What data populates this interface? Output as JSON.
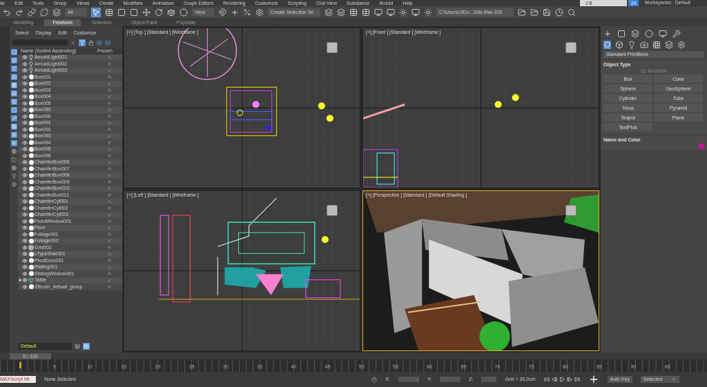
{
  "menu": [
    "ile",
    "Edit",
    "Tools",
    "Group",
    "Views",
    "Create",
    "Modifiers",
    "Animation",
    "Graph Editors",
    "Rendering",
    "Customize",
    "Scripting",
    "Civil View",
    "Substance",
    "Arnold",
    "Help"
  ],
  "account": {
    "user": "J B",
    "badge": "24",
    "workspaces_label": "Workspaces:",
    "workspace": "Default"
  },
  "toolbar": {
    "selection_filter": "All",
    "reference_coord": "View",
    "named_selection": "Create Selection Se",
    "project_path": "C:\\Users\\J\\Do...\\3ds Max 202"
  },
  "ribbon_tabs": [
    {
      "label": "Modeling",
      "selected": false
    },
    {
      "label": "Freeform",
      "selected": true
    },
    {
      "label": "Selection",
      "selected": false
    },
    {
      "label": "Object Paint",
      "selected": false
    },
    {
      "label": "Populate",
      "selected": false
    }
  ],
  "scene_explorer": {
    "menu": [
      "Select",
      "Display",
      "Edit",
      "Customize"
    ],
    "columns": [
      "Name (Sorted Ascending)",
      "Frozen"
    ],
    "rows": [
      {
        "name": "ArnoldLight001",
        "kind": "light"
      },
      {
        "name": "ArnoldLight002",
        "kind": "light"
      },
      {
        "name": "ArnoldLight003",
        "kind": "light"
      },
      {
        "name": "Box001",
        "kind": "object"
      },
      {
        "name": "Box002",
        "kind": "object"
      },
      {
        "name": "Box003",
        "kind": "object"
      },
      {
        "name": "Box004",
        "kind": "object"
      },
      {
        "name": "Box005",
        "kind": "object"
      },
      {
        "name": "Box089",
        "kind": "object"
      },
      {
        "name": "Box090",
        "kind": "object"
      },
      {
        "name": "Box091",
        "kind": "object"
      },
      {
        "name": "Box092",
        "kind": "object"
      },
      {
        "name": "Box093",
        "kind": "object"
      },
      {
        "name": "Box094",
        "kind": "object"
      },
      {
        "name": "Box095",
        "kind": "object"
      },
      {
        "name": "Box096",
        "kind": "object"
      },
      {
        "name": "ChamferBox006",
        "kind": "object"
      },
      {
        "name": "ChamferBox007",
        "kind": "object"
      },
      {
        "name": "ChamferBox008",
        "kind": "object"
      },
      {
        "name": "ChamferBox009",
        "kind": "object"
      },
      {
        "name": "ChamferBox010",
        "kind": "object"
      },
      {
        "name": "ChamferBox011",
        "kind": "object"
      },
      {
        "name": "ChamferCyl001",
        "kind": "object"
      },
      {
        "name": "ChamferCyl002",
        "kind": "object"
      },
      {
        "name": "ChamferCyl003",
        "kind": "object"
      },
      {
        "name": "FixedWindow001",
        "kind": "object"
      },
      {
        "name": "Floor",
        "kind": "object"
      },
      {
        "name": "Foliage001",
        "kind": "object"
      },
      {
        "name": "Foliage002",
        "kind": "object"
      },
      {
        "name": "Grid002",
        "kind": "grid"
      },
      {
        "name": "LTypeStair001",
        "kind": "object"
      },
      {
        "name": "PivotDoor001",
        "kind": "object"
      },
      {
        "name": "Railing001",
        "kind": "object"
      },
      {
        "name": "SlidingWindow001",
        "kind": "object"
      },
      {
        "name": "Table",
        "kind": "group"
      },
      {
        "name": "ZBrush_defualt_group",
        "kind": "object"
      }
    ],
    "layer": "Default"
  },
  "viewports": [
    {
      "label": "[+] [Top ] [Standard ] [Wireframe ]",
      "kind": "top",
      "active": false
    },
    {
      "label": "[+] [Front ] [Standard ] [Wireframe ]",
      "kind": "front",
      "active": false
    },
    {
      "label": "[+] [Left ] [Standard ] [Wireframe ]",
      "kind": "left",
      "active": false
    },
    {
      "label": "[+] [Perspective ] [Standard ] [Default Shading ]",
      "kind": "perspective",
      "active": true
    }
  ],
  "command_panel": {
    "category": "Standard Primitives",
    "object_type": {
      "title": "Object Type",
      "autogrid": {
        "label": "AutoGrid",
        "checked": false
      },
      "buttons": [
        "Box",
        "Cone",
        "Sphere",
        "GeoSphere",
        "Cylinder",
        "Tube",
        "Torus",
        "Pyramid",
        "Teapot",
        "Plane",
        "TextPlus"
      ]
    },
    "name_and_color": {
      "title": "Name and Color",
      "color": "#c21a8c"
    }
  },
  "timeline": {
    "frame": "0 / 100",
    "ticks": [
      "5",
      "10",
      "15",
      "20",
      "25",
      "30",
      "35",
      "40",
      "45",
      "50",
      "55",
      "60",
      "65",
      "70",
      "75",
      "80",
      "85",
      "90",
      "95"
    ]
  },
  "status": {
    "script": "MAXScript Mi:",
    "selection": "None Selected",
    "x_label": "X:",
    "y_label": "Y:",
    "z_label": "Z:",
    "grid": "Grid = 30,0cm",
    "auto_key": "Auto Key",
    "key_filter": "Selected"
  }
}
